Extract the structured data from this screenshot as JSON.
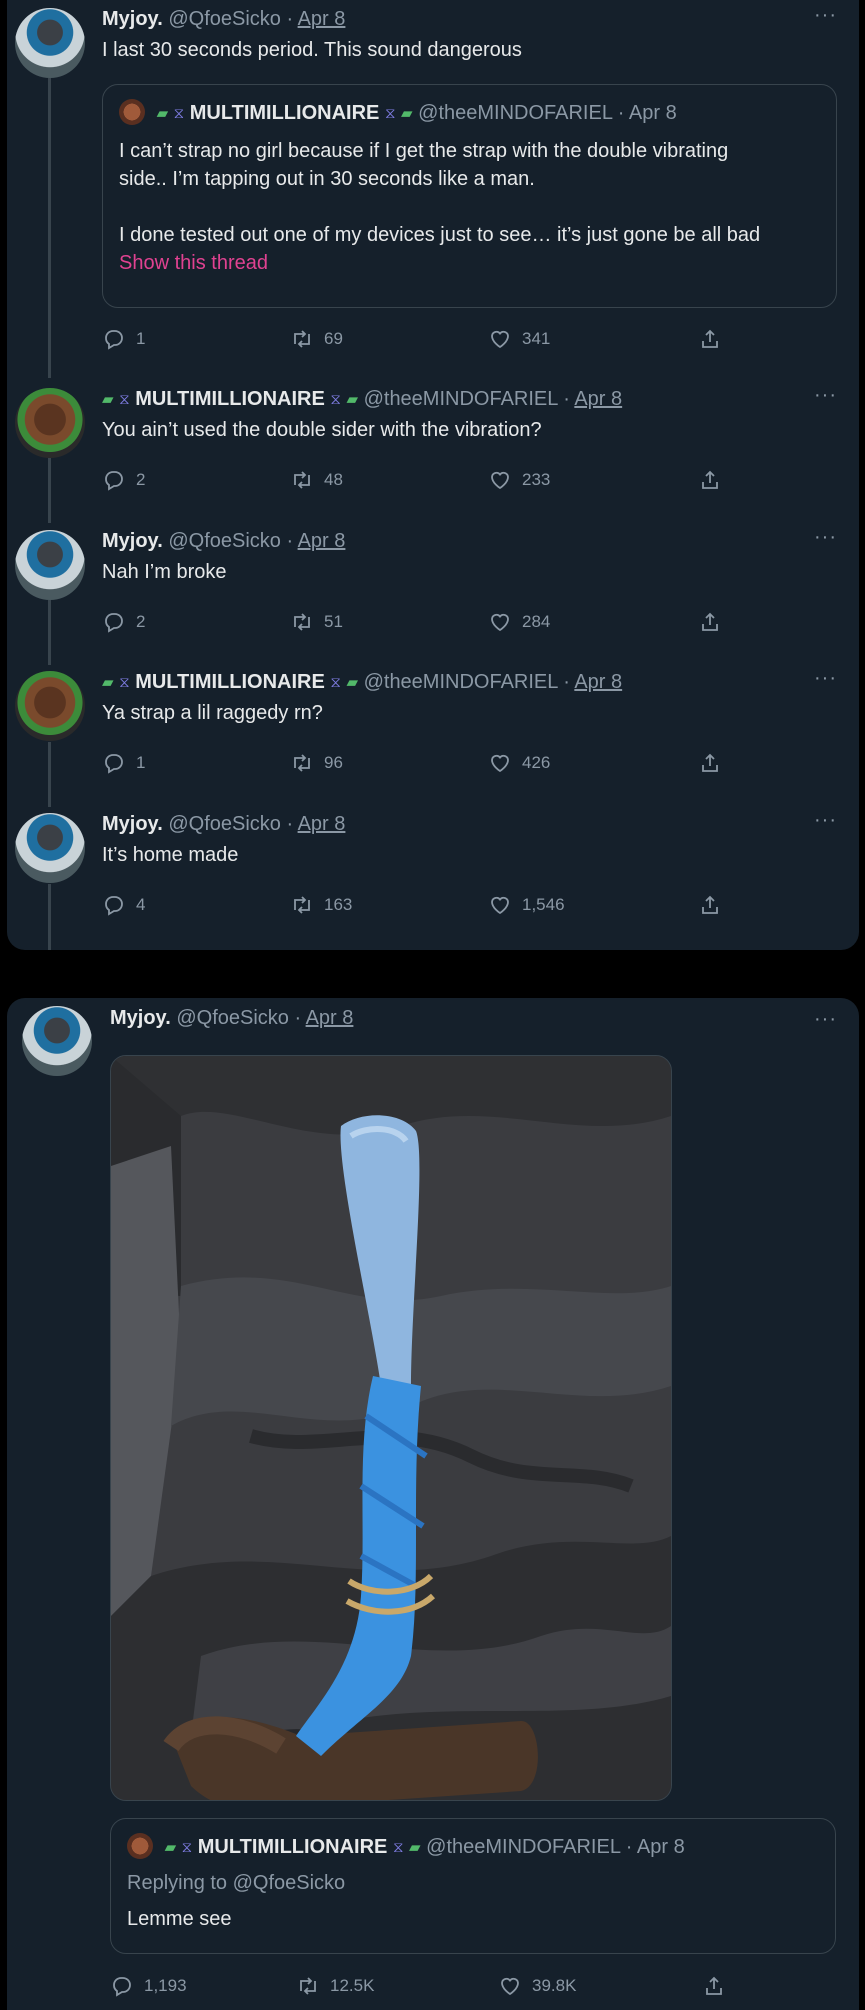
{
  "icons": {
    "more": "more-horizontal-icon",
    "reply": "reply-icon",
    "retweet": "retweet-icon",
    "like": "heart-icon",
    "share": "share-icon"
  },
  "colors": {
    "background": "#15202b",
    "border": "#38444d",
    "muted": "#8b98a5",
    "thread_link": "#e04291"
  },
  "users": {
    "myjoy": {
      "name": "Myjoy.",
      "handle": "@QfoeSicko"
    },
    "multi": {
      "name": "MULTIMILLIONAIRE",
      "handle": "@theeMINDOFARIEL"
    }
  },
  "separator": "·",
  "more_label": "···",
  "tweets": [
    {
      "date": "Apr 8",
      "text": "I last 30 seconds period. This sound dangerous",
      "quote": {
        "date": "Apr 8",
        "line1": "I can’t strap no girl because if I get the strap with the double vibrating",
        "line2": "side.. I’m tapping out in 30 seconds like a man.",
        "line3": "I done tested out one of my devices just to see… it’s just gone be all bad",
        "show_thread": "Show this thread"
      },
      "replies": "1",
      "retweets": "69",
      "likes": "341"
    },
    {
      "date": "Apr 8",
      "text": "You ain’t used the double sider with the vibration?",
      "replies": "2",
      "retweets": "48",
      "likes": "233"
    },
    {
      "date": "Apr 8",
      "text": "Nah I’m broke",
      "replies": "2",
      "retweets": "51",
      "likes": "284"
    },
    {
      "date": "Apr 8",
      "text": "Ya strap a lil raggedy rn?",
      "replies": "1",
      "retweets": "96",
      "likes": "426"
    },
    {
      "date": "Apr 8",
      "text": "It’s home made",
      "replies": "4",
      "retweets": "163",
      "likes": "1,546"
    }
  ],
  "main_tweet": {
    "date": "Apr 8",
    "quote": {
      "date": "Apr 8",
      "replying_to": "Replying to @QfoeSicko",
      "text": "Lemme see"
    },
    "replies": "1,193",
    "retweets": "12.5K",
    "likes": "39.8K"
  }
}
